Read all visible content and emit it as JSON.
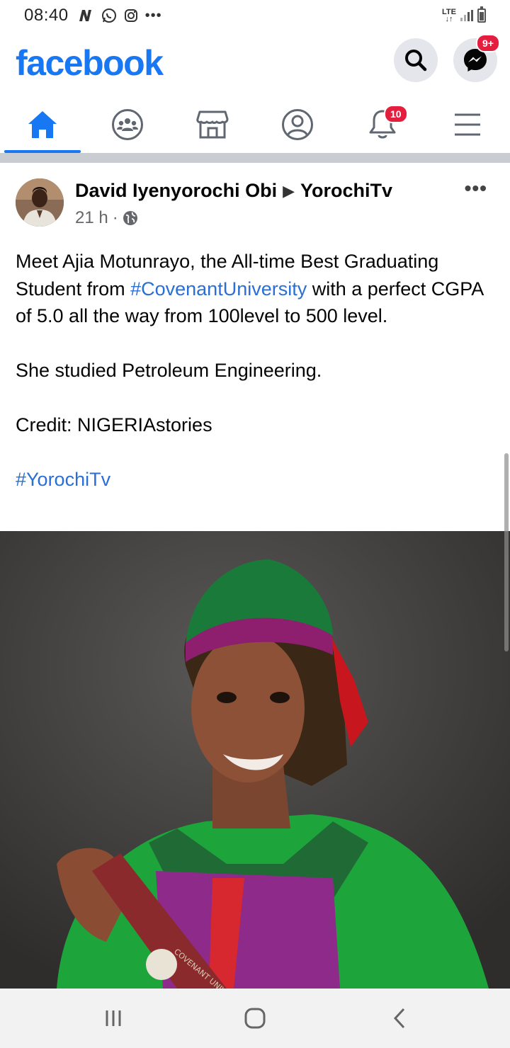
{
  "status_bar": {
    "time": "08:40",
    "network": "LTE"
  },
  "header": {
    "logo": "facebook",
    "brand_color": "#1877f2",
    "messenger_badge": "9+"
  },
  "tabs": [
    {
      "name": "home",
      "icon": "home-icon",
      "active": true
    },
    {
      "name": "groups",
      "icon": "groups-icon",
      "active": false
    },
    {
      "name": "marketplace",
      "icon": "marketplace-icon",
      "active": false
    },
    {
      "name": "profile",
      "icon": "profile-icon",
      "active": false
    },
    {
      "name": "notifications",
      "icon": "bell-icon",
      "active": false,
      "badge": "10"
    },
    {
      "name": "menu",
      "icon": "hamburger-icon",
      "active": false
    }
  ],
  "post": {
    "author": "David Iyenyorochi Obi",
    "target": "YorochiTv",
    "time": "21 h",
    "privacy_icon": "globe-icon",
    "text": {
      "p1_before": "Meet Ajia Motunrayo, the All-time Best Graduating Student from ",
      "p1_hashtag": "#CovenantUniversity",
      "p1_after": " with a perfect CGPA of 5.0 all the way from 100level to 500 level.",
      "p2": "She studied Petroleum Engineering.",
      "p3": "Credit: NIGERIAstories",
      "p4_hashtag": "#YorochiTv"
    },
    "photo_stamp_text": "COVENANT UNIVERSITY"
  },
  "navbar": {
    "recent_icon": "recent-apps-icon",
    "home_icon": "home-button-icon",
    "back_icon": "back-icon"
  }
}
